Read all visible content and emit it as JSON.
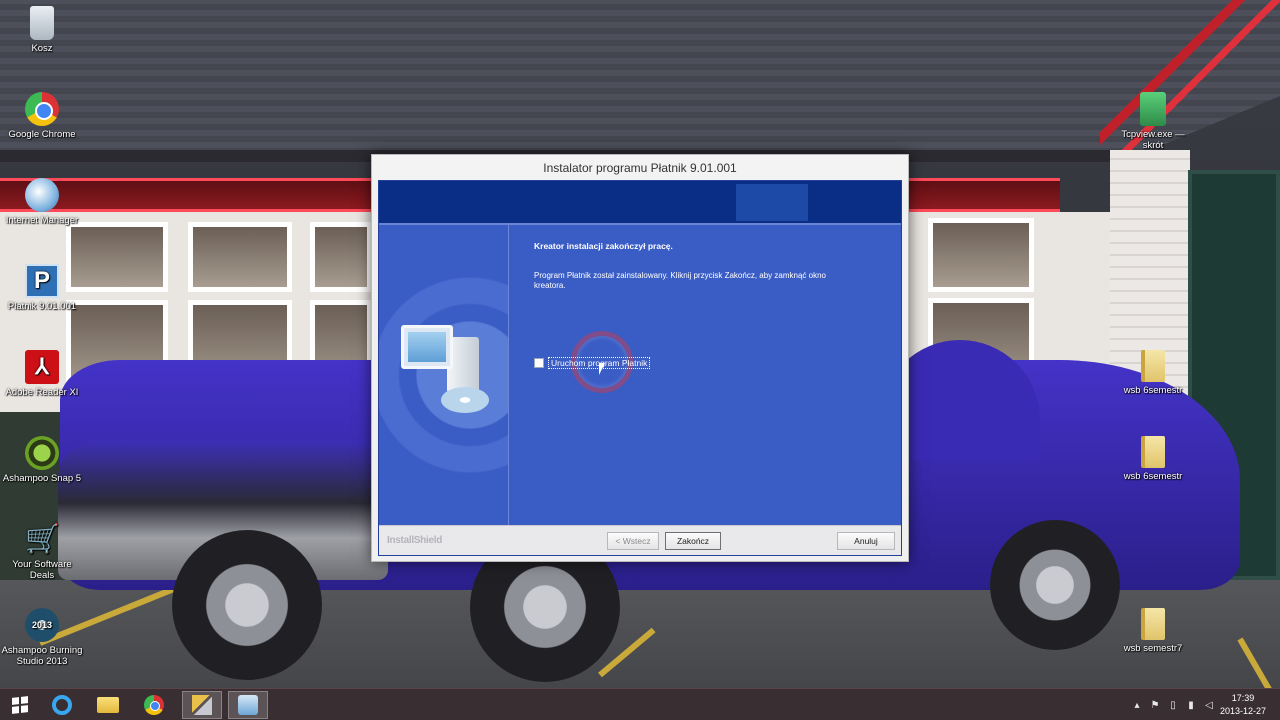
{
  "desktop": {
    "icons_left": [
      {
        "label": "Kosz",
        "icon": "recycle-bin-icon"
      },
      {
        "label": "Google Chrome",
        "icon": "chrome-icon"
      },
      {
        "label": "Internet Manager",
        "icon": "internet-download-manager-icon"
      },
      {
        "label": "Płatnik 9.01.001",
        "icon": "platnik-icon"
      },
      {
        "label": "Adobe Reader XI",
        "icon": "adobe-reader-icon"
      },
      {
        "label": "Ashampoo Snap 5",
        "icon": "ashampoo-snap-icon"
      },
      {
        "label": "Your Software Deals",
        "icon": "shopping-cart-icon"
      },
      {
        "label": "Ashampoo Burning Studio 2013",
        "icon": "burning-studio-icon",
        "badge": "2013"
      }
    ],
    "icons_right": [
      {
        "label": "Tcpview.exe — skrót",
        "icon": "tcpview-icon"
      },
      {
        "label": "wsb 6semestr",
        "icon": "folder-icon"
      },
      {
        "label": "wsb 6semestr",
        "icon": "folder-icon"
      },
      {
        "label": "wsb semestr7",
        "icon": "folder-icon"
      }
    ]
  },
  "installer": {
    "title": "Instalator programu Płatnik 9.01.001",
    "heading": "Kreator instalacji zakończył pracę.",
    "description": "Program Płatnik został zainstalowany. Kliknij przycisk Zakończ, aby zamknąć okno kreatora.",
    "checkbox": {
      "label": "Uruchom program Płatnik",
      "checked": false
    },
    "brand": "InstallShield",
    "buttons": {
      "back": "< Wstecz",
      "finish": "Zakończ",
      "cancel": "Anuluj"
    }
  },
  "taskbar": {
    "apps": [
      "start-icon",
      "internet-explorer-icon",
      "file-explorer-icon",
      "chrome-icon",
      "tools-icon",
      "installer-icon"
    ],
    "tray": {
      "show_hidden": "▴",
      "icons": [
        "flag-icon",
        "device-icon",
        "network-icon",
        "volume-icon"
      ]
    },
    "clock": {
      "time": "17:39",
      "date": "2013-12-27"
    }
  }
}
